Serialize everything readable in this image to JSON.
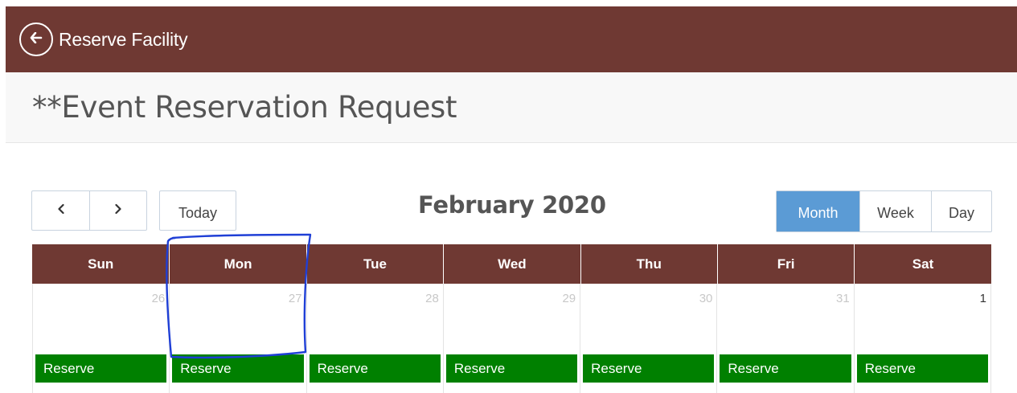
{
  "header": {
    "title": "Reserve Facility",
    "back_icon": "arrow-left-icon",
    "background": "#6f3933"
  },
  "page": {
    "title": "**Event Reservation Request"
  },
  "calendar": {
    "nav": {
      "prev_icon": "chevron-left-icon",
      "next_icon": "chevron-right-icon",
      "today_label": "Today"
    },
    "month_title": "February 2020",
    "views": [
      {
        "label": "Month",
        "active": true
      },
      {
        "label": "Week",
        "active": false
      },
      {
        "label": "Day",
        "active": false
      }
    ],
    "weekdays": [
      "Sun",
      "Mon",
      "Tue",
      "Wed",
      "Thu",
      "Fri",
      "Sat"
    ],
    "days": [
      {
        "num": "26",
        "current": false,
        "action": "Reserve"
      },
      {
        "num": "27",
        "current": false,
        "action": "Reserve"
      },
      {
        "num": "28",
        "current": false,
        "action": "Reserve"
      },
      {
        "num": "29",
        "current": false,
        "action": "Reserve"
      },
      {
        "num": "30",
        "current": false,
        "action": "Reserve"
      },
      {
        "num": "31",
        "current": false,
        "action": "Reserve"
      },
      {
        "num": "1",
        "current": true,
        "action": "Reserve"
      }
    ],
    "colors": {
      "header": "#6f3933",
      "reserve": "#008000",
      "active_view": "#5b9bd5",
      "annotation": "#1f3fd6"
    }
  }
}
